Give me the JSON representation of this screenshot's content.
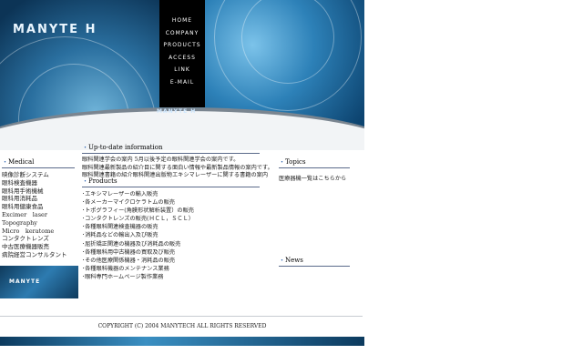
{
  "brand": {
    "logo": "MANYTE H",
    "arc_logo": "MANYTE H",
    "sidebar_logo": "MANYTE"
  },
  "nav": [
    {
      "label": "HOME"
    },
    {
      "label": "COMPANY"
    },
    {
      "label": "PRODUCTS"
    },
    {
      "label": "ACCESS"
    },
    {
      "label": "LINK"
    },
    {
      "label": "E-MAIL"
    }
  ],
  "medical": {
    "title": "Medical",
    "items": [
      "映像診断システム",
      "眼科検査機器",
      "眼科用手術機械",
      "眼科用消耗品",
      "眼科用健康食品",
      "Excimer　laser",
      "Topography",
      "Micro　keratome",
      "コンタクトレンズ",
      "中古医療機器販売",
      "病院経営コンサルタント"
    ]
  },
  "update": {
    "title": "Up-to-date information",
    "lines": [
      "眼科関連学会の案内 5月以後予定の眼科関連学会の案内です。",
      "眼科関連最新製品の紹介目に関する面白い情報や最新製品情報の案内です。",
      "眼科関連書籍の紹介眼科関連出版物エキシマレーザーに関する書籍の案内"
    ]
  },
  "products": {
    "title": "Products",
    "items": [
      "･エキシマレーザーの輸入販売",
      "･各メーカーマイクロケラトムの販売",
      "･トポグラフィー(角膜形状解析装置）の販売",
      "･コンタクトレンズの販売(ＨＣＬ，ＳＣＬ）",
      "･各種眼科関連検査機器の販売",
      "･消耗品などの輸出入及び販売",
      "･屈折矯正関連の機器及び消耗品の販売",
      "･各種眼科用中古機器の買取及び販売",
      "･その他医療関係機器・消耗品の販売",
      "･各種眼科機器のメンテナンス業務",
      "･眼科専門ホームページ製作業務"
    ]
  },
  "topics": {
    "title": "Topics",
    "link": "医療器機一覧はこちらから"
  },
  "news": {
    "title": "News"
  },
  "footer": {
    "copyright": "COPYRIGHT (C) 2004 MANYTECH ALL RIGHTS RESERVED"
  },
  "colors": {
    "nav_bg": "#000000",
    "accent": "#2a62b0",
    "banner_blue": "#1f6a9e"
  }
}
